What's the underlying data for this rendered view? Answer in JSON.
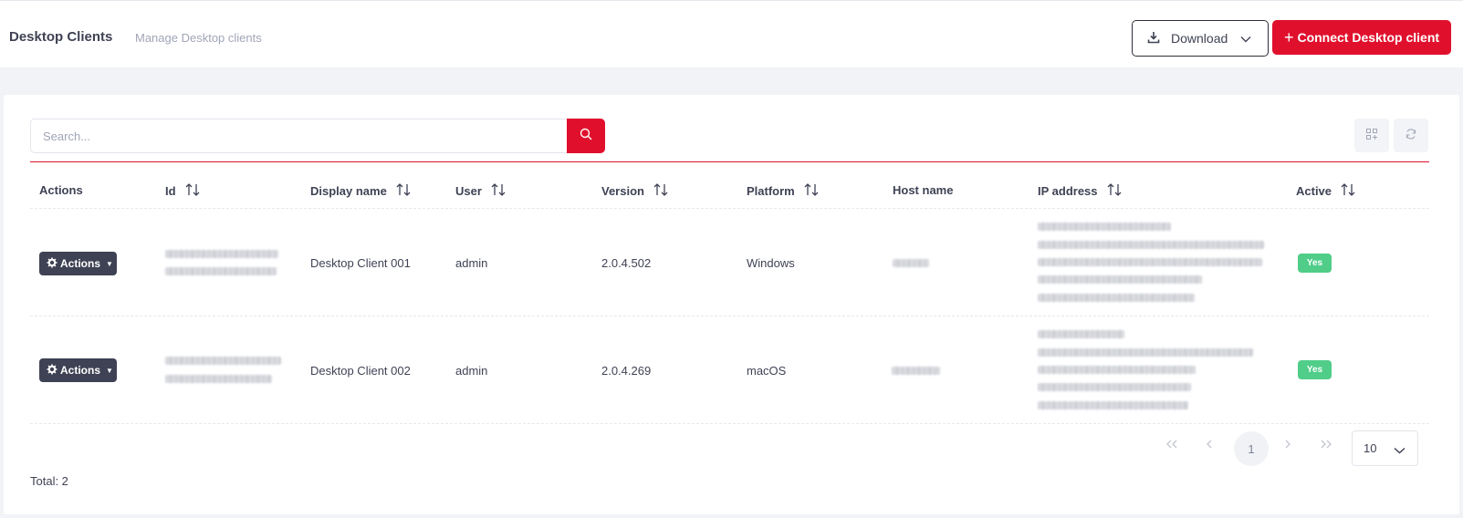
{
  "header": {
    "title": "Desktop Clients",
    "subtitle": "Manage Desktop clients",
    "download_label": "Download",
    "connect_label": "Connect Desktop client"
  },
  "search": {
    "placeholder": "Search..."
  },
  "table": {
    "columns": [
      "Actions",
      "Id",
      "Display name",
      "User",
      "Version",
      "Platform",
      "Host name",
      "IP address",
      "Active"
    ],
    "rows": [
      {
        "actions_label": "Actions",
        "display_name": "Desktop Client 001",
        "user": "admin",
        "version": "2.0.4.502",
        "platform": "Windows",
        "active": "Yes"
      },
      {
        "actions_label": "Actions",
        "display_name": "Desktop Client 002",
        "user": "admin",
        "version": "2.0.4.269",
        "platform": "macOS",
        "active": "Yes"
      }
    ]
  },
  "pagination": {
    "current_page": "1",
    "page_size": "10"
  },
  "footer": {
    "total": "Total: 2"
  },
  "colors": {
    "accent": "#e0102d",
    "dark": "#3f4254",
    "success": "#50cd89",
    "muted": "#a1a5b7"
  },
  "icons": [
    "download-icon",
    "chevron-down-icon",
    "plus-icon",
    "search-icon",
    "columns-icon",
    "refresh-icon",
    "sort-icon",
    "gear-icon",
    "first-page-icon",
    "prev-page-icon",
    "next-page-icon",
    "last-page-icon"
  ]
}
